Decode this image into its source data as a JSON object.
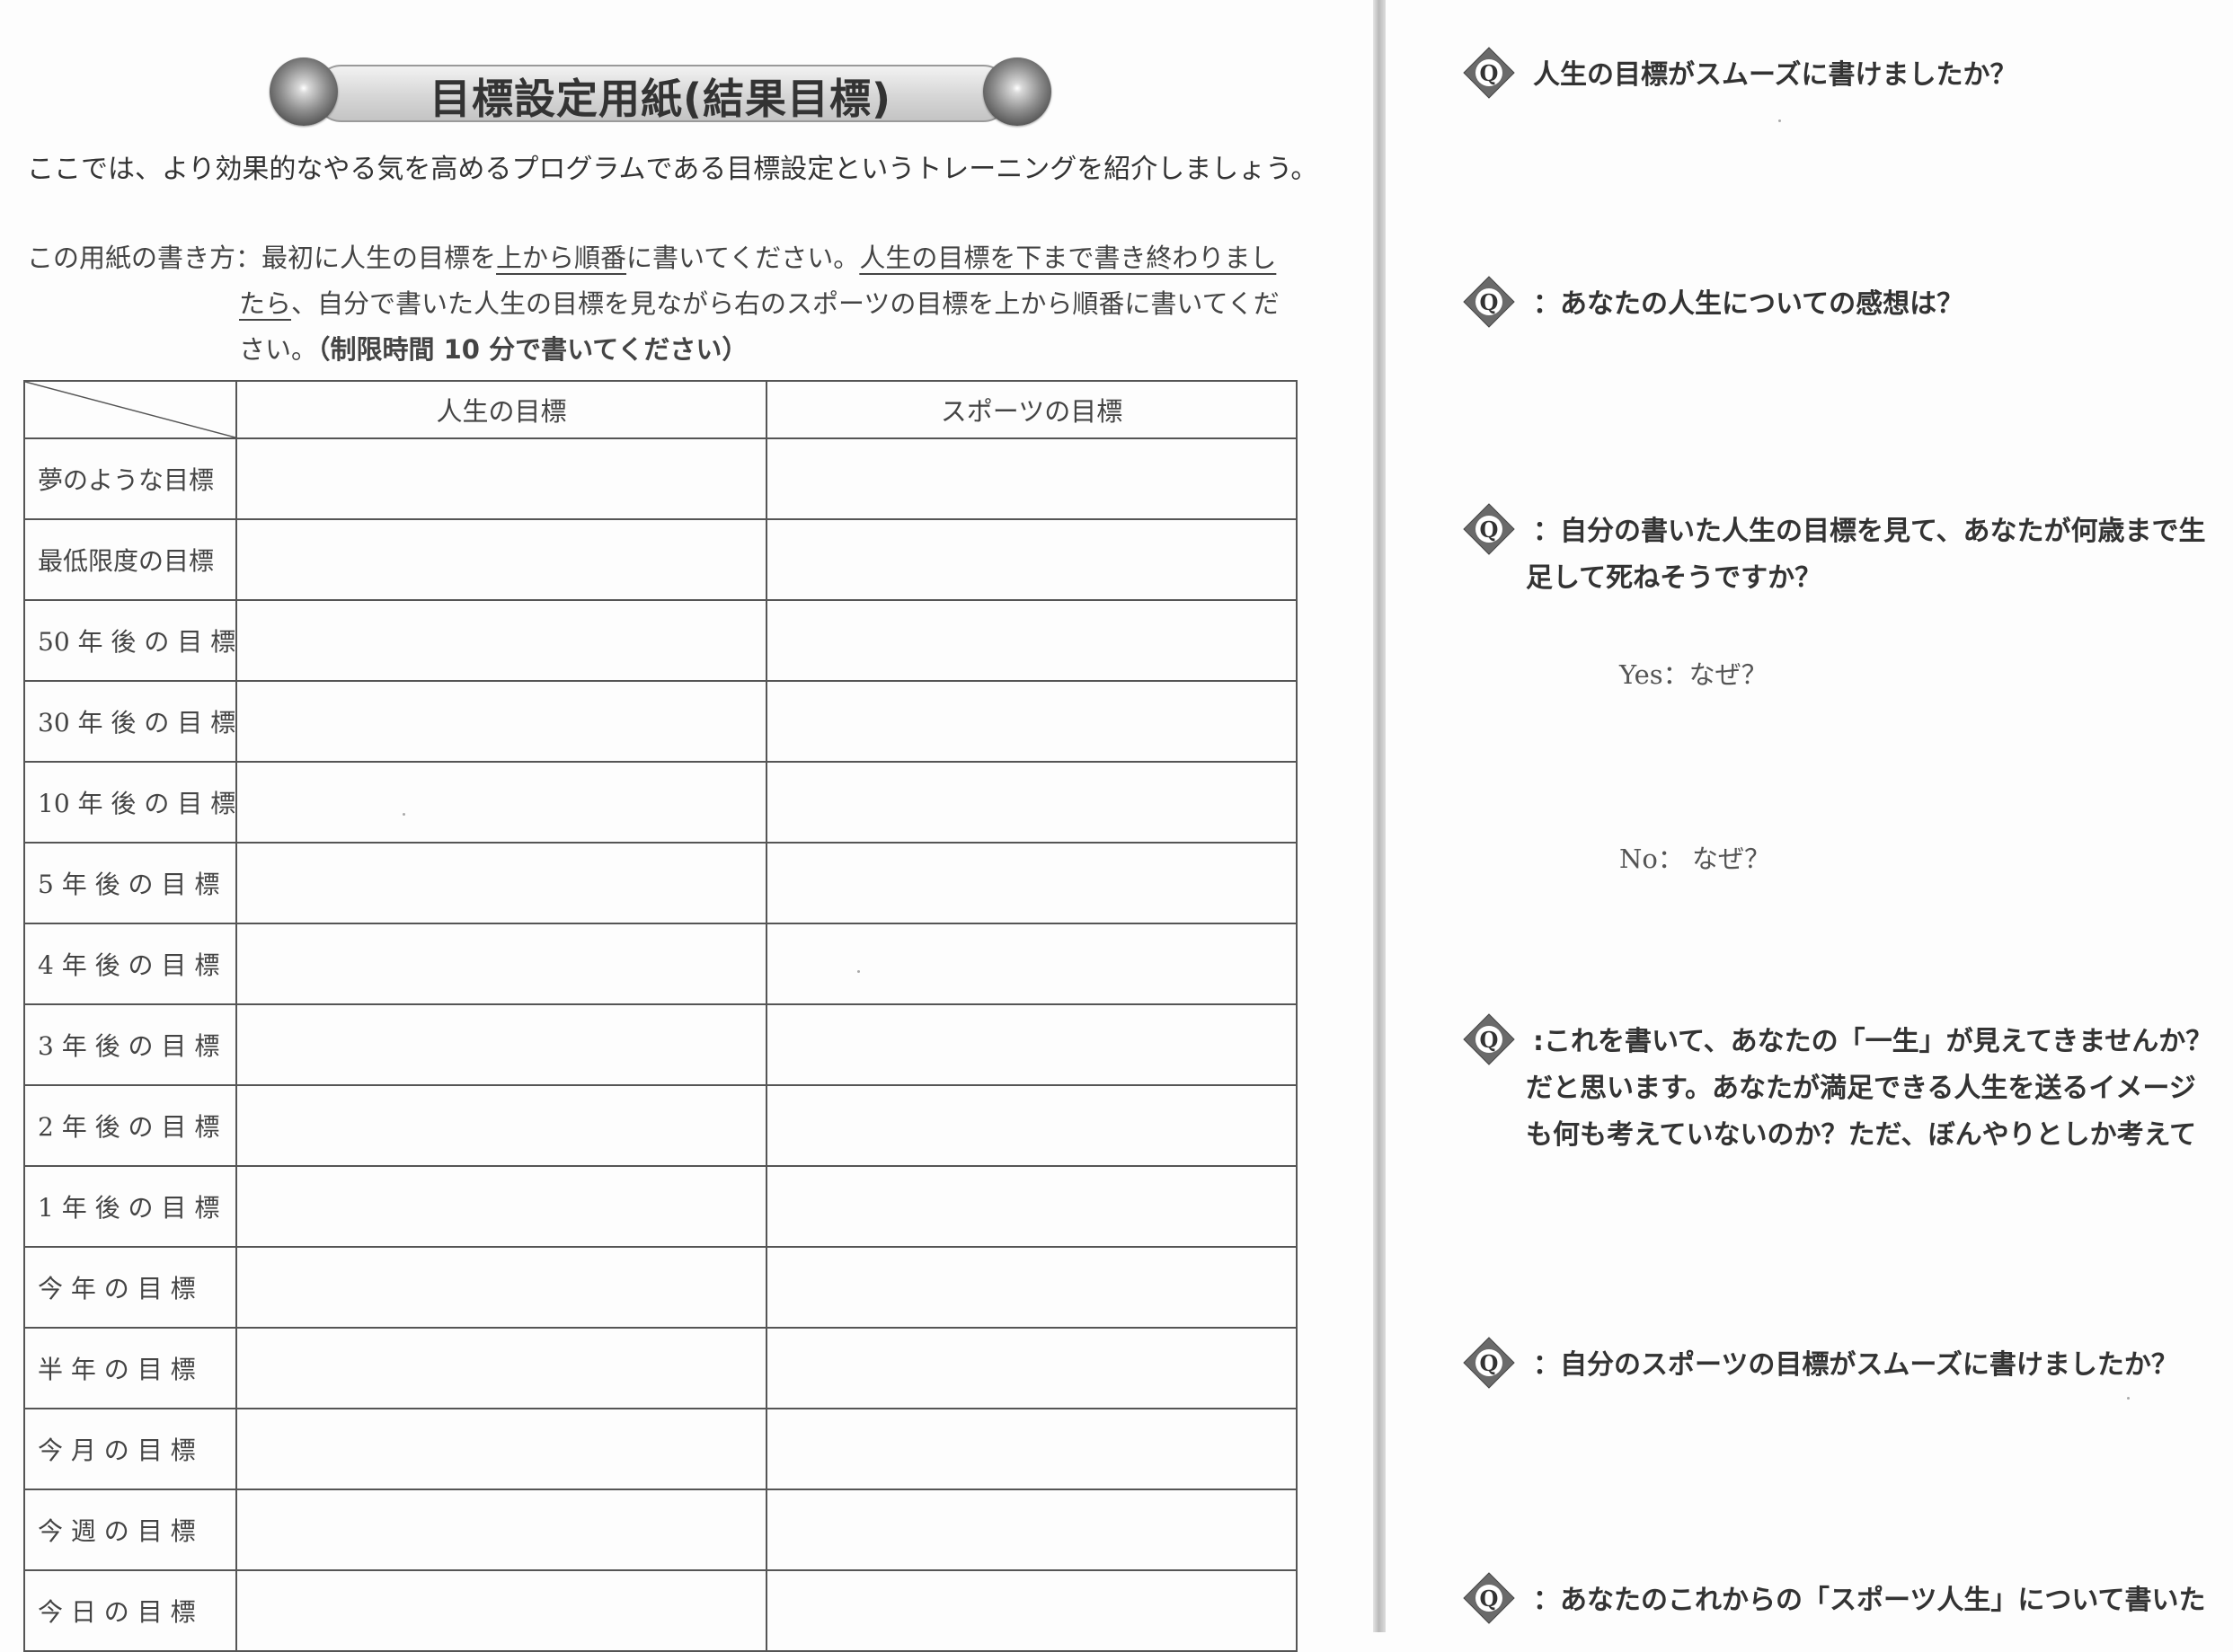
{
  "title": "目標設定用紙(結果目標)",
  "intro": "ここでは、より効果的なやる気を高めるプログラムである目標設定というトレーニングを紹介しましょう。",
  "instructions": {
    "label": "この用紙の書き方：",
    "l1_a": "最初に人生の目標を",
    "l1_u1": "上から順番",
    "l1_b": "に書いてください。",
    "l1_u2": "人生の目標を下まで書き終わりまし",
    "l2_u": "たら",
    "l2_b": "、自分で書いた人生の目標を見ながら右のスポーツの目標を上から順番に書いてくだ",
    "l3_a": "さい。",
    "l3_bold": "（制限時間 10 分で書いてください）"
  },
  "table": {
    "headers": [
      "人生の目標",
      "スポーツの目標"
    ],
    "rows": [
      "夢のような目標",
      "最低限度の目標",
      "50 年 後 の 目 標",
      "30 年 後 の 目 標",
      "10 年 後 の 目 標",
      "5 年 後 の 目 標",
      "4 年 後 の 目 標",
      "3 年 後 の 目 標",
      "2 年 後 の 目 標",
      "1 年 後 の 目 標",
      "今 年 の 目 標",
      "半 年 の 目 標",
      "今 月 の 目 標",
      "今 週 の 目 標",
      "今 日 の 目 標"
    ]
  },
  "questions": [
    {
      "lines": [
        "人生の目標がスムーズに書けましたか？"
      ]
    },
    {
      "lines": [
        "：あなたの人生についての感想は？"
      ]
    },
    {
      "lines": [
        "：自分の書いた人生の目標を見て、あなたが何歳まで生",
        "足して死ねそうですか？"
      ]
    },
    {
      "lines": [
        ":これを書いて、あなたの「一生」が見えてきませんか？",
        "だと思います。あなたが満足できる人生を送るイメージ",
        "も何も考えていないのか？ただ、ぼんやりとしか考えて"
      ]
    },
    {
      "lines": [
        "：自分のスポーツの目標がスムーズに書けましたか？"
      ]
    },
    {
      "lines": [
        "：あなたのこれからの「スポーツ人生」について書いた"
      ]
    }
  ],
  "answers": {
    "yes": "Yes：なぜ？",
    "no": "No：  なぜ？"
  },
  "q_icon_letter": "Q"
}
